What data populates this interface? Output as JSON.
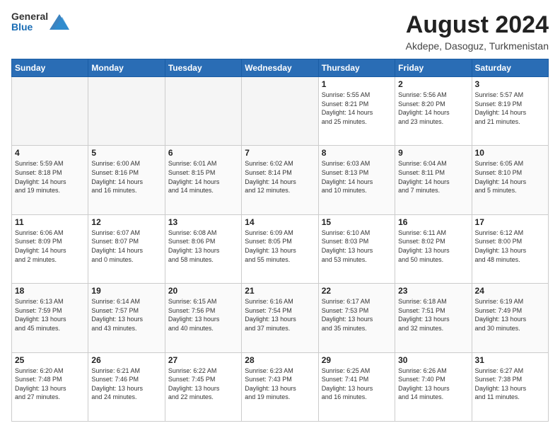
{
  "header": {
    "logo": {
      "general": "General",
      "blue": "Blue"
    },
    "month": "August 2024",
    "location": "Akdepe, Dasoguz, Turkmenistan"
  },
  "weekdays": [
    "Sunday",
    "Monday",
    "Tuesday",
    "Wednesday",
    "Thursday",
    "Friday",
    "Saturday"
  ],
  "weeks": [
    [
      {
        "day": "",
        "info": ""
      },
      {
        "day": "",
        "info": ""
      },
      {
        "day": "",
        "info": ""
      },
      {
        "day": "",
        "info": ""
      },
      {
        "day": "1",
        "info": "Sunrise: 5:55 AM\nSunset: 8:21 PM\nDaylight: 14 hours\nand 25 minutes."
      },
      {
        "day": "2",
        "info": "Sunrise: 5:56 AM\nSunset: 8:20 PM\nDaylight: 14 hours\nand 23 minutes."
      },
      {
        "day": "3",
        "info": "Sunrise: 5:57 AM\nSunset: 8:19 PM\nDaylight: 14 hours\nand 21 minutes."
      }
    ],
    [
      {
        "day": "4",
        "info": "Sunrise: 5:59 AM\nSunset: 8:18 PM\nDaylight: 14 hours\nand 19 minutes."
      },
      {
        "day": "5",
        "info": "Sunrise: 6:00 AM\nSunset: 8:16 PM\nDaylight: 14 hours\nand 16 minutes."
      },
      {
        "day": "6",
        "info": "Sunrise: 6:01 AM\nSunset: 8:15 PM\nDaylight: 14 hours\nand 14 minutes."
      },
      {
        "day": "7",
        "info": "Sunrise: 6:02 AM\nSunset: 8:14 PM\nDaylight: 14 hours\nand 12 minutes."
      },
      {
        "day": "8",
        "info": "Sunrise: 6:03 AM\nSunset: 8:13 PM\nDaylight: 14 hours\nand 10 minutes."
      },
      {
        "day": "9",
        "info": "Sunrise: 6:04 AM\nSunset: 8:11 PM\nDaylight: 14 hours\nand 7 minutes."
      },
      {
        "day": "10",
        "info": "Sunrise: 6:05 AM\nSunset: 8:10 PM\nDaylight: 14 hours\nand 5 minutes."
      }
    ],
    [
      {
        "day": "11",
        "info": "Sunrise: 6:06 AM\nSunset: 8:09 PM\nDaylight: 14 hours\nand 2 minutes."
      },
      {
        "day": "12",
        "info": "Sunrise: 6:07 AM\nSunset: 8:07 PM\nDaylight: 14 hours\nand 0 minutes."
      },
      {
        "day": "13",
        "info": "Sunrise: 6:08 AM\nSunset: 8:06 PM\nDaylight: 13 hours\nand 58 minutes."
      },
      {
        "day": "14",
        "info": "Sunrise: 6:09 AM\nSunset: 8:05 PM\nDaylight: 13 hours\nand 55 minutes."
      },
      {
        "day": "15",
        "info": "Sunrise: 6:10 AM\nSunset: 8:03 PM\nDaylight: 13 hours\nand 53 minutes."
      },
      {
        "day": "16",
        "info": "Sunrise: 6:11 AM\nSunset: 8:02 PM\nDaylight: 13 hours\nand 50 minutes."
      },
      {
        "day": "17",
        "info": "Sunrise: 6:12 AM\nSunset: 8:00 PM\nDaylight: 13 hours\nand 48 minutes."
      }
    ],
    [
      {
        "day": "18",
        "info": "Sunrise: 6:13 AM\nSunset: 7:59 PM\nDaylight: 13 hours\nand 45 minutes."
      },
      {
        "day": "19",
        "info": "Sunrise: 6:14 AM\nSunset: 7:57 PM\nDaylight: 13 hours\nand 43 minutes."
      },
      {
        "day": "20",
        "info": "Sunrise: 6:15 AM\nSunset: 7:56 PM\nDaylight: 13 hours\nand 40 minutes."
      },
      {
        "day": "21",
        "info": "Sunrise: 6:16 AM\nSunset: 7:54 PM\nDaylight: 13 hours\nand 37 minutes."
      },
      {
        "day": "22",
        "info": "Sunrise: 6:17 AM\nSunset: 7:53 PM\nDaylight: 13 hours\nand 35 minutes."
      },
      {
        "day": "23",
        "info": "Sunrise: 6:18 AM\nSunset: 7:51 PM\nDaylight: 13 hours\nand 32 minutes."
      },
      {
        "day": "24",
        "info": "Sunrise: 6:19 AM\nSunset: 7:49 PM\nDaylight: 13 hours\nand 30 minutes."
      }
    ],
    [
      {
        "day": "25",
        "info": "Sunrise: 6:20 AM\nSunset: 7:48 PM\nDaylight: 13 hours\nand 27 minutes."
      },
      {
        "day": "26",
        "info": "Sunrise: 6:21 AM\nSunset: 7:46 PM\nDaylight: 13 hours\nand 24 minutes."
      },
      {
        "day": "27",
        "info": "Sunrise: 6:22 AM\nSunset: 7:45 PM\nDaylight: 13 hours\nand 22 minutes."
      },
      {
        "day": "28",
        "info": "Sunrise: 6:23 AM\nSunset: 7:43 PM\nDaylight: 13 hours\nand 19 minutes."
      },
      {
        "day": "29",
        "info": "Sunrise: 6:25 AM\nSunset: 7:41 PM\nDaylight: 13 hours\nand 16 minutes."
      },
      {
        "day": "30",
        "info": "Sunrise: 6:26 AM\nSunset: 7:40 PM\nDaylight: 13 hours\nand 14 minutes."
      },
      {
        "day": "31",
        "info": "Sunrise: 6:27 AM\nSunset: 7:38 PM\nDaylight: 13 hours\nand 11 minutes."
      }
    ]
  ]
}
